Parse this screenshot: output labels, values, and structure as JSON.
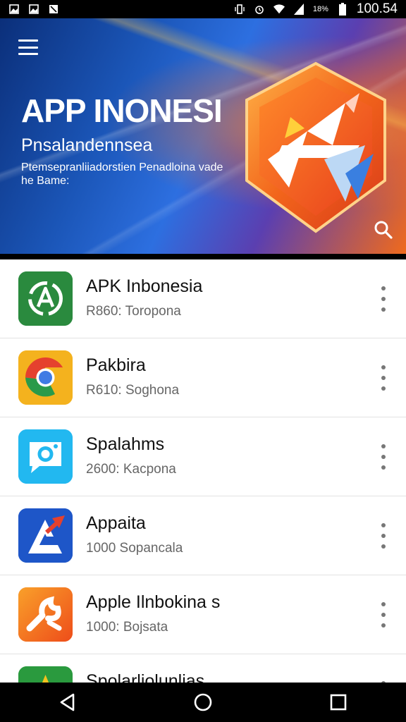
{
  "status_bar": {
    "time": "100.54",
    "battery_percent": "18%",
    "left_icons": [
      "image-notification-icon",
      "image-notification-icon",
      "photo-notification-icon"
    ],
    "right_icons": [
      "vibrate-icon",
      "alarm-icon",
      "wifi-icon",
      "signal-icon",
      "battery-icon"
    ]
  },
  "hero": {
    "title": "APP INONESI",
    "subtitle": "Pnsalandennsea",
    "description": "Ptemsepranliiadorstien Penadloina vade he Bame:",
    "logo_icon": "star-shield-logo-icon",
    "menu_icon": "hamburger-menu-icon",
    "search_icon": "search-icon"
  },
  "apps": [
    {
      "name": "APK Inbonesia",
      "meta": "R860: Toropona",
      "icon": "refresh-a-icon",
      "color": "#2a8a3e"
    },
    {
      "name": "Pakbira",
      "meta": "R610: Soghona",
      "icon": "chrome-icon",
      "color": "#e5412e"
    },
    {
      "name": "Spalahms",
      "meta": "2600: Kacpona",
      "icon": "camera-chat-icon",
      "color": "#22b8f0"
    },
    {
      "name": "Appaita",
      "meta": "1000 Sopancala",
      "icon": "a-logo-icon",
      "color": "#1e56c8"
    },
    {
      "name": "Apple Ilnbokina s",
      "meta": "1000: Bojsata",
      "icon": "wrench-icon",
      "color": "#f26a1c"
    },
    {
      "name": "Spolarliolunlias",
      "meta": "",
      "icon": "star-green-icon",
      "color": "#2a9a3e"
    }
  ],
  "nav": {
    "back_icon": "back-triangle-icon",
    "home_icon": "home-circle-icon",
    "recents_icon": "recents-square-icon"
  }
}
